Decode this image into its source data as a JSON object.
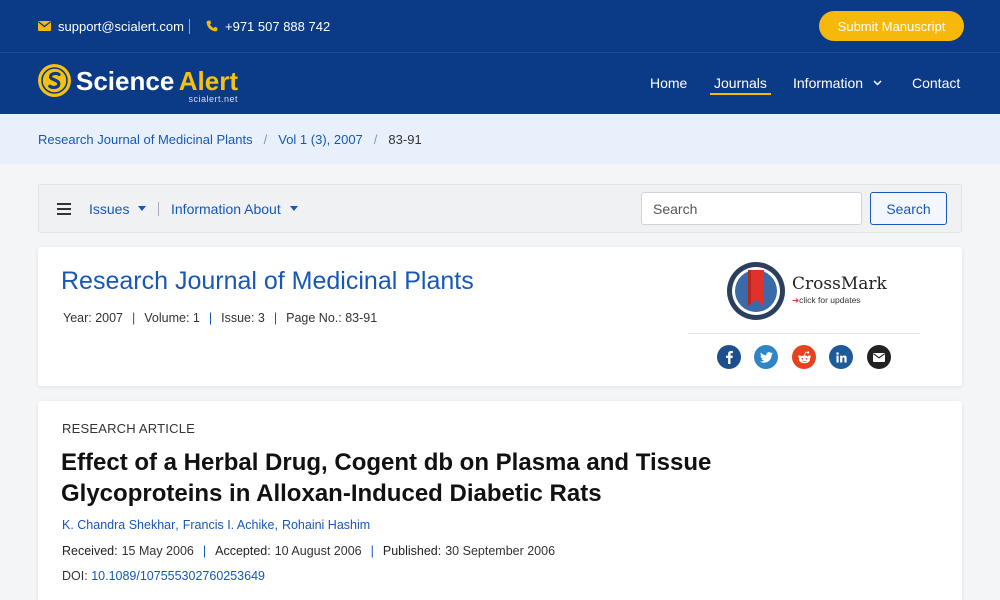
{
  "topbar": {
    "email": "support@scialert.com",
    "phone": "+971 507 888 742",
    "submit_label": "Submit Manuscript"
  },
  "brand": {
    "name_part1": "Science",
    "name_part2": "Alert",
    "subtitle": "scialert.net"
  },
  "nav": {
    "home": "Home",
    "journals": "Journals",
    "information": "Information",
    "contact": "Contact"
  },
  "breadcrumb": {
    "items": [
      "Research Journal of Medicinal Plants",
      "Vol 1 (3), 2007",
      "83-91"
    ],
    "separator": "/"
  },
  "subnav": {
    "issues": "Issues",
    "information_about": "Information About",
    "search_placeholder": "Search",
    "search_button": "Search"
  },
  "journal": {
    "title": "Research Journal of Medicinal Plants",
    "meta": [
      "Year: 2007",
      "Volume: 1",
      "Issue: 3",
      "Page No.: 83-91"
    ],
    "crossmark_title": "CrossMark",
    "crossmark_sub": "click for updates"
  },
  "share_icons": [
    "facebook-icon",
    "twitter-icon",
    "reddit-icon",
    "linkedin-icon",
    "email-icon"
  ],
  "article": {
    "type": "RESEARCH ARTICLE",
    "title": "Effect of a Herbal Drug, Cogent db on Plasma and Tissue Glycoproteins in Alloxan-Induced Diabetic Rats",
    "authors": [
      "K. Chandra Shekhar",
      "Francis I. Achike",
      "Rohaini Hashim"
    ],
    "received_label": "Received:",
    "received": "15 May 2006",
    "accepted_label": "Accepted:",
    "accepted": "10 August 2006",
    "published_label": "Published:",
    "published": "30 September 2006",
    "doi_label": "DOI:",
    "doi": "10.1089/107555302760253649"
  },
  "colors": {
    "brand_blue": "#0b3a86",
    "accent_yellow": "#f6b80b",
    "link_blue": "#1757b9"
  }
}
